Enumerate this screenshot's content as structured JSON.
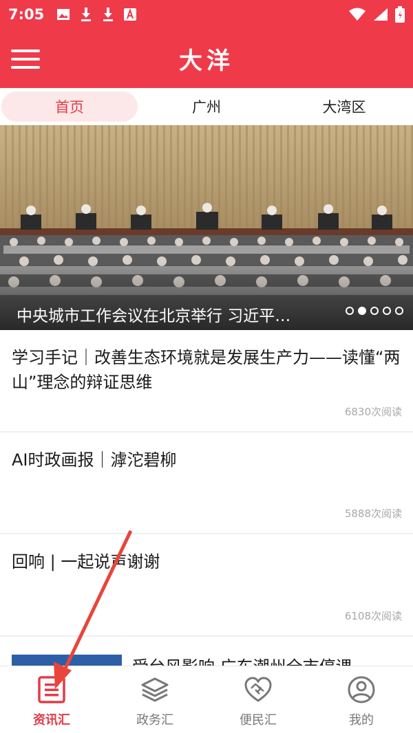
{
  "status_bar": {
    "time": "7:05"
  },
  "app_bar": {
    "title": "大洋"
  },
  "tabs": [
    {
      "label": "首页",
      "active": true
    },
    {
      "label": "广州",
      "active": false
    },
    {
      "label": "大湾区",
      "active": false
    }
  ],
  "banner": {
    "caption": "中央城市工作会议在北京举行 习近平…",
    "active_dot_index": 1,
    "dot_count": 5
  },
  "articles": [
    {
      "title": "学习手记｜改善生态环境就是发展生产力——读懂“两山”理念的辩证思维",
      "reads": "6830次阅读"
    },
    {
      "title": "AI时政画报｜滹沱碧柳",
      "reads": "5888次阅读"
    },
    {
      "title": "回响 | 一起说声谢谢",
      "reads": "6108次阅读"
    }
  ],
  "partial_article": {
    "title": "受台风影响 广东潮州全市停课"
  },
  "bottom_nav": [
    {
      "label": "资讯汇",
      "icon": "news-icon",
      "active": true
    },
    {
      "label": "政务汇",
      "icon": "layers-icon",
      "active": false
    },
    {
      "label": "便民汇",
      "icon": "handshake-icon",
      "active": false
    },
    {
      "label": "我的",
      "icon": "profile-icon",
      "active": false
    }
  ],
  "colors": {
    "brand": "#ef3a4a",
    "active_tab_bg": "#fde8e9",
    "active_text": "#e23b47"
  }
}
